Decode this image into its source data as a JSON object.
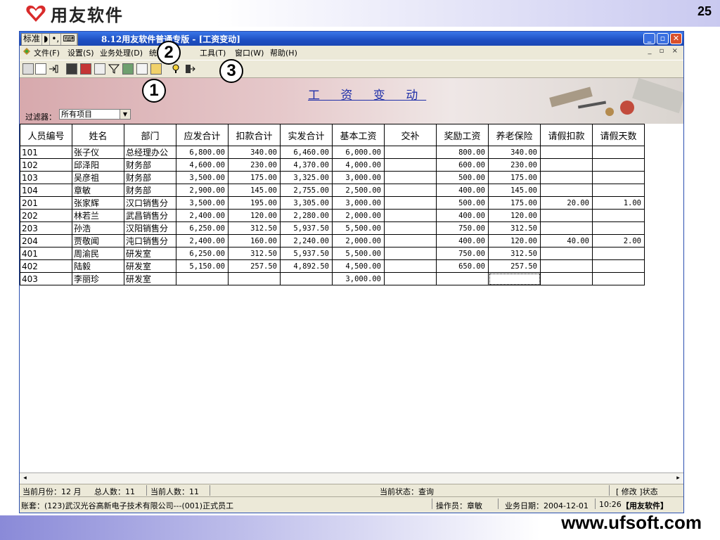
{
  "slide": {
    "logo_text": "用友软件",
    "page_number": "25",
    "website": "www.ufsoft.com"
  },
  "window": {
    "ime": [
      "标准",
      "◗",
      "•,",
      "⌨"
    ],
    "title": "8.12用友软件普通专版 - [工资变动]",
    "controls": [
      "_",
      "▫",
      "✕"
    ]
  },
  "menu": {
    "items": [
      "文件(F)",
      "设置(S)",
      "业务处理(D)",
      "统",
      "工具(T)",
      "窗口(W)",
      "帮助(H)"
    ],
    "mdi_controls": "_ ▫ ×"
  },
  "toolbar": {
    "icons": [
      "print-icon",
      "print-preview-icon",
      "export-icon",
      "calculator-icon",
      "sum-icon",
      "edit-icon",
      "filter-icon",
      "locate-icon",
      "replace-icon",
      "display-icon",
      "help-icon",
      "exit-icon"
    ]
  },
  "banner": {
    "title": "工 资 变 动",
    "filter_label": "过滤器：",
    "filter_value": "所有项目"
  },
  "grid": {
    "headers": [
      "人员编号",
      "姓名",
      "部门",
      "应发合计",
      "扣款合计",
      "实发合计",
      "基本工资",
      "交补",
      "奖励工资",
      "养老保险",
      "请假扣款",
      "请假天数"
    ],
    "rows": [
      [
        "101",
        "张子仪",
        "总经理办公",
        "6,800.00",
        "340.00",
        "6,460.00",
        "6,000.00",
        "",
        "800.00",
        "340.00",
        "",
        ""
      ],
      [
        "102",
        "邱泽阳",
        "财务部",
        "4,600.00",
        "230.00",
        "4,370.00",
        "4,000.00",
        "",
        "600.00",
        "230.00",
        "",
        ""
      ],
      [
        "103",
        "吴彦祖",
        "财务部",
        "3,500.00",
        "175.00",
        "3,325.00",
        "3,000.00",
        "",
        "500.00",
        "175.00",
        "",
        ""
      ],
      [
        "104",
        "章敏",
        "财务部",
        "2,900.00",
        "145.00",
        "2,755.00",
        "2,500.00",
        "",
        "400.00",
        "145.00",
        "",
        ""
      ],
      [
        "201",
        "张家辉",
        "汉口销售分",
        "3,500.00",
        "195.00",
        "3,305.00",
        "3,000.00",
        "",
        "500.00",
        "175.00",
        "20.00",
        "1.00"
      ],
      [
        "202",
        "林若兰",
        "武昌销售分",
        "2,400.00",
        "120.00",
        "2,280.00",
        "2,000.00",
        "",
        "400.00",
        "120.00",
        "",
        ""
      ],
      [
        "203",
        "孙浩",
        "汉阳销售分",
        "6,250.00",
        "312.50",
        "5,937.50",
        "5,500.00",
        "",
        "750.00",
        "312.50",
        "",
        ""
      ],
      [
        "204",
        "贾敬闻",
        "沌口销售分",
        "2,400.00",
        "160.00",
        "2,240.00",
        "2,000.00",
        "",
        "400.00",
        "120.00",
        "40.00",
        "2.00"
      ],
      [
        "401",
        "周渝民",
        "研发室",
        "6,250.00",
        "312.50",
        "5,937.50",
        "5,500.00",
        "",
        "750.00",
        "312.50",
        "",
        ""
      ],
      [
        "402",
        "陆毅",
        "研发室",
        "5,150.00",
        "257.50",
        "4,892.50",
        "4,500.00",
        "",
        "650.00",
        "257.50",
        "",
        ""
      ],
      [
        "403",
        "李丽珍",
        "研发室",
        "",
        "",
        "",
        "3,000.00",
        "",
        "",
        "",
        "",
        ""
      ]
    ]
  },
  "status": {
    "month": "当前月份：12 月",
    "total": "总人数：11",
    "current": "当前人数：11",
    "state": "当前状态：查询",
    "mode": "[ 修改 ]状态",
    "account": "账套：(123)武汉光谷高新电子技术有限公司---(001)正式员工",
    "operator": "操作员：章敏",
    "date": "业务日期：2004-12-01",
    "time": "10:26",
    "brand": "【用友软件】"
  },
  "callouts": [
    "1",
    "2",
    "3"
  ]
}
